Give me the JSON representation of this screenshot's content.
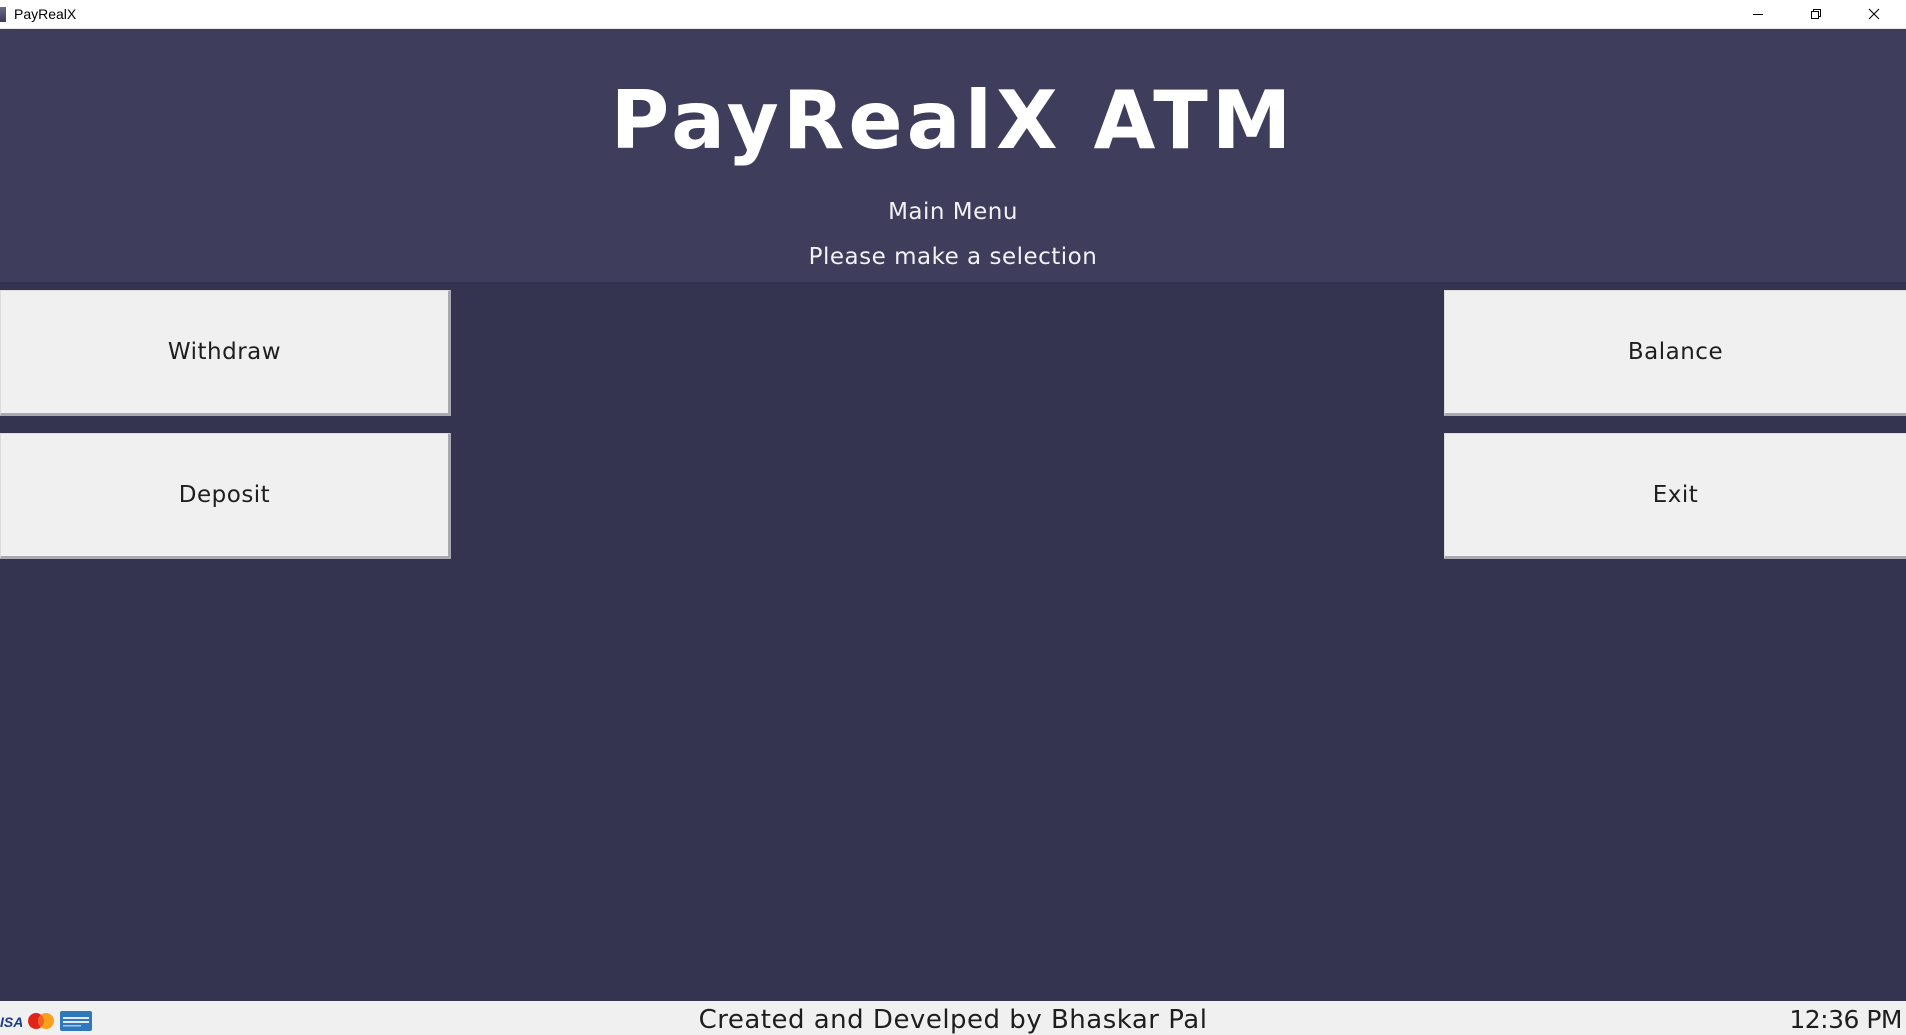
{
  "window": {
    "title": "PayRealX",
    "icons": {
      "app": "app-icon",
      "minimize": "minimize-icon",
      "maximize": "restore-icon",
      "close": "close-icon"
    }
  },
  "header": {
    "app_heading": "PayRealX ATM",
    "menu_title": "Main Menu",
    "prompt": "Please make a selection"
  },
  "menu": {
    "withdraw_label": "Withdraw",
    "deposit_label": "Deposit",
    "balance_label": "Balance",
    "exit_label": "Exit"
  },
  "footer": {
    "card_logos": [
      "visa-logo",
      "mastercard-logo",
      "amex-logo"
    ],
    "visa_text": "ISA",
    "credit": "Created and Develped by Bhaskar Pal",
    "clock": "12:36 PM"
  },
  "colors": {
    "background": "#343350",
    "header_band": "#3e3d5c",
    "button_face": "#f0f0f0",
    "footer_bar": "#f0f0f0",
    "heading_text": "#ffffff"
  }
}
